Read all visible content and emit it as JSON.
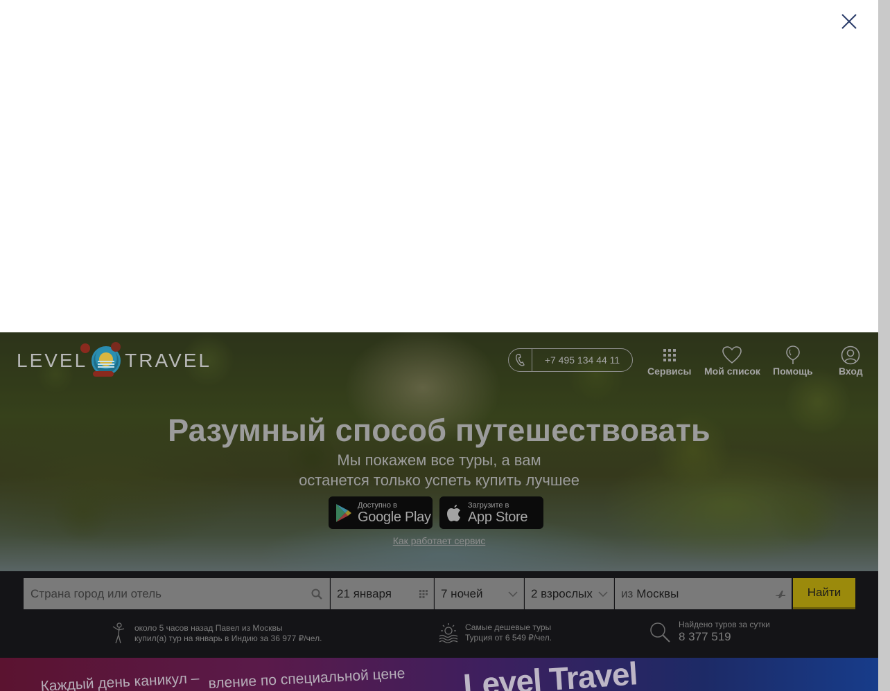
{
  "modal": {
    "close_icon": "close-icon"
  },
  "header": {
    "logo_left": "LEVEL",
    "logo_right": "TRAVEL",
    "phone": "+7 495 134 44 11",
    "nav": [
      {
        "label": "Сервисы",
        "icon": "grid-icon"
      },
      {
        "label": "Мой список",
        "icon": "heart-icon"
      },
      {
        "label": "Помощь",
        "icon": "balloon-icon"
      },
      {
        "label": "Вход",
        "icon": "user-icon"
      }
    ]
  },
  "hero": {
    "title": "Разумный способ путешествовать",
    "subtitle_line1": "Мы покажем все туры, а вам",
    "subtitle_line2": "останется только успеть купить лучшее",
    "google_play_small": "Доступно в",
    "google_play_big": "Google Play",
    "app_store_small": "Загрузите в",
    "app_store_big": "App Store",
    "how_link": "Как работает сервис"
  },
  "search": {
    "destination_placeholder": "Страна город или отель",
    "date": "21 января",
    "nights": "7 ночей",
    "guests": "2 взрослых",
    "from_prefix": "из",
    "from_city": "Москвы",
    "submit": "Найти"
  },
  "info": {
    "recent_line1": "около 5 часов назад Павел из Москвы",
    "recent_line2": "купил(а) тур на январь в Индию за 36 977 ₽/чел.",
    "cheap_line1": "Самые дешевые туры",
    "cheap_line2": "Турция от 6 549 ₽/чел.",
    "found_label": "Найдено туров за сутки",
    "found_count": "8 377 519"
  },
  "promo": {
    "line1": "Каждый день каникул –",
    "line2": "вление по специальной цене",
    "brand": "Level Travel"
  },
  "colors": {
    "accent_button": "#9b8a0c",
    "band": "#141417"
  }
}
